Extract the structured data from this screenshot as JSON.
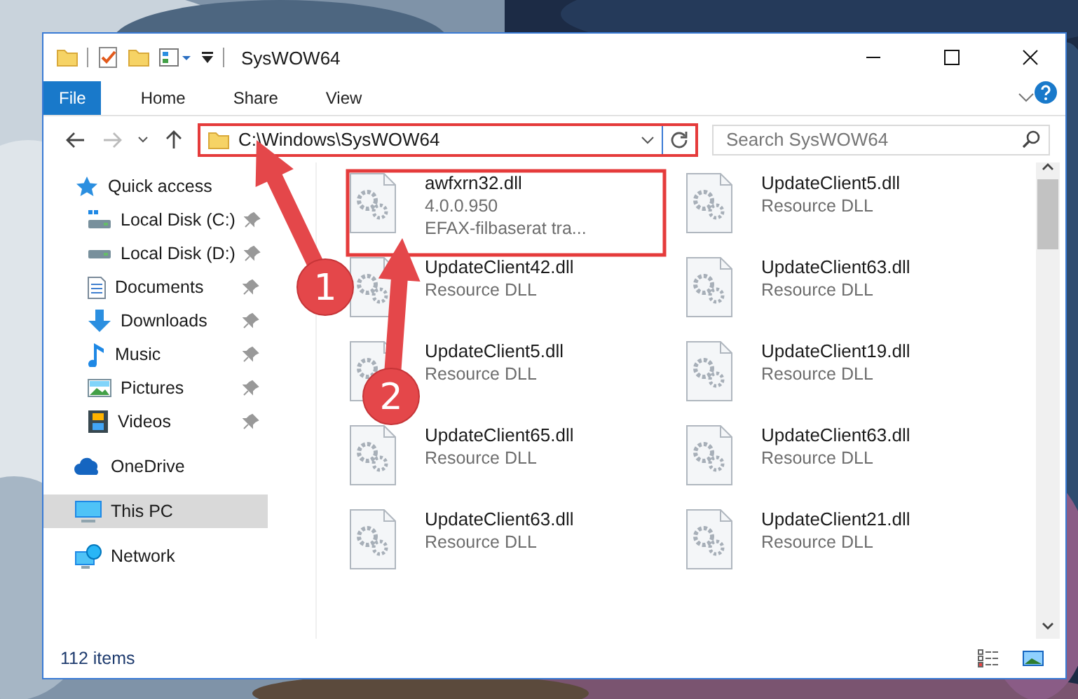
{
  "window": {
    "title": "SysWOW64"
  },
  "ribbon": {
    "tabs": [
      {
        "label": "File",
        "kind": "file",
        "selected": false
      },
      {
        "label": "Home",
        "kind": "tab",
        "selected": false
      },
      {
        "label": "Share",
        "kind": "tab",
        "selected": false
      },
      {
        "label": "View",
        "kind": "tab",
        "selected": false
      }
    ]
  },
  "address": {
    "path": "C:\\Windows\\SysWOW64",
    "search_placeholder": "Search SysWOW64"
  },
  "nav": [
    {
      "label": "Quick access",
      "selected": false,
      "children": [
        {
          "label": "Local Disk (C:)",
          "pinned": true,
          "selected": false
        },
        {
          "label": "Local Disk (D:)",
          "pinned": true,
          "selected": false
        },
        {
          "label": "Documents",
          "pinned": true,
          "selected": false
        },
        {
          "label": "Downloads",
          "pinned": true,
          "selected": false
        },
        {
          "label": "Music",
          "pinned": true,
          "selected": false
        },
        {
          "label": "Pictures",
          "pinned": true,
          "selected": false
        },
        {
          "label": "Videos",
          "pinned": true,
          "selected": false
        }
      ]
    },
    {
      "label": "OneDrive",
      "selected": false
    },
    {
      "label": "This PC",
      "selected": true
    },
    {
      "label": "Network",
      "selected": false
    }
  ],
  "files": [
    {
      "name": "awfxrn32.dll",
      "details": [
        "4.0.0.950",
        "EFAX-filbaserat tra..."
      ]
    },
    {
      "name": "UpdateClient5.dll",
      "details": [
        "Resource DLL"
      ]
    },
    {
      "name": "UpdateClient42.dll",
      "details": [
        "Resource DLL"
      ]
    },
    {
      "name": "UpdateClient63.dll",
      "details": [
        "Resource DLL"
      ]
    },
    {
      "name": "UpdateClient5.dll",
      "details": [
        "Resource DLL"
      ]
    },
    {
      "name": "UpdateClient19.dll",
      "details": [
        "Resource DLL"
      ]
    },
    {
      "name": "UpdateClient65.dll",
      "details": [
        "Resource DLL"
      ]
    },
    {
      "name": "UpdateClient63.dll",
      "details": [
        "Resource DLL"
      ]
    },
    {
      "name": "UpdateClient63.dll",
      "details": [
        "Resource DLL"
      ]
    },
    {
      "name": "UpdateClient21.dll",
      "details": [
        "Resource DLL"
      ]
    }
  ],
  "status_bar": {
    "count": "112 items"
  },
  "annotations": {
    "badges": [
      {
        "label": "1"
      },
      {
        "label": "2"
      }
    ]
  }
}
